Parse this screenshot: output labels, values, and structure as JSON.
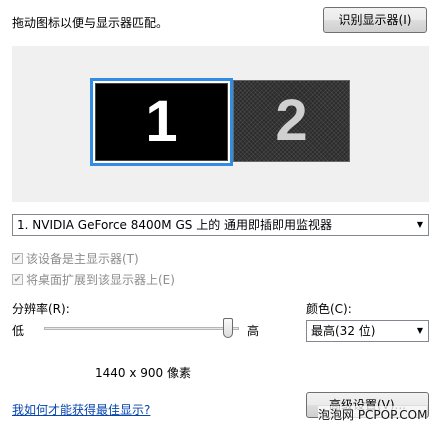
{
  "instruction": "拖动图标以便与显示器匹配。",
  "identify_button": "识别显示器(I)",
  "monitors": [
    {
      "number": "1",
      "selected": true
    },
    {
      "number": "2",
      "selected": false
    }
  ],
  "display_select": "1. NVIDIA GeForce 8400M GS  上的 通用即插即用监视器",
  "checkboxes": [
    {
      "label": "该设备是主显示器(T)",
      "checked": true,
      "disabled": true
    },
    {
      "label": "将桌面扩展到该显示器上(E)",
      "checked": true,
      "disabled": true
    }
  ],
  "resolution": {
    "label": "分辨率(R):",
    "low": "低",
    "high": "高",
    "value": "1440 x 900 像素",
    "slider_level": 1.0
  },
  "color": {
    "label": "颜色(C):",
    "selected": "最高(32 位)"
  },
  "help_link": "我如何才能获得最佳显示?",
  "advanced_button": "高级设置(V)...",
  "watermark": "泡泡网 PCPOP.COM",
  "colors": {
    "selection_border": "#2f8de4",
    "link": "#0645ad"
  }
}
